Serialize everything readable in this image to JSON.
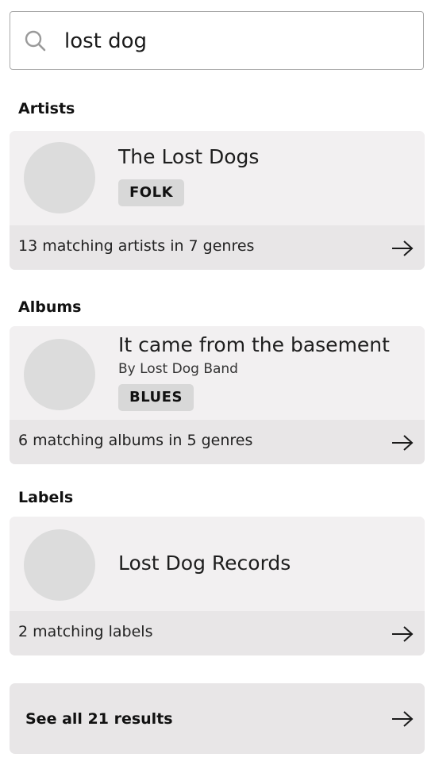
{
  "search": {
    "query": "lost dog",
    "icon": "search-icon"
  },
  "artists": {
    "section_title": "Artists",
    "top_result": {
      "name": "The Lost Dogs",
      "genre": "FOLK"
    },
    "summary": "13 matching artists in 7 genres"
  },
  "albums": {
    "section_title": "Albums",
    "top_result": {
      "title": "It came from the basement",
      "byline": "By Lost Dog Band",
      "genre": "BLUES"
    },
    "summary": "6 matching albums in 5 genres"
  },
  "labels": {
    "section_title": "Labels",
    "top_result": {
      "name": "Lost Dog Records"
    },
    "summary": "2 matching labels"
  },
  "see_all": {
    "label": "See all 21 results"
  },
  "colors": {
    "card_background": "#f2f0f1",
    "card_footer": "#e8e6e7",
    "avatar_placeholder": "#dcdcdc",
    "tag_background": "#d8d8d8"
  }
}
